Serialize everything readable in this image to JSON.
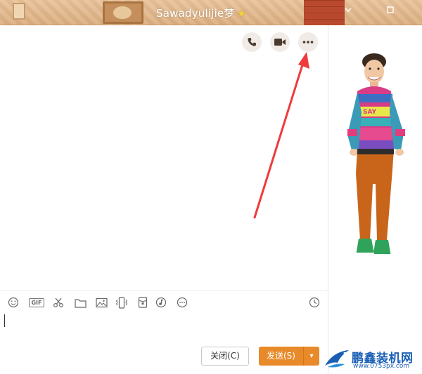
{
  "window": {
    "title": "Sawadyulijie梦",
    "title_badge": "★",
    "minimize_icon": "chevron-down",
    "maximize_icon": "square"
  },
  "chat_actions": [
    {
      "name": "voice-call",
      "icon": "phone-icon"
    },
    {
      "name": "video-call",
      "icon": "video-camera-icon"
    },
    {
      "name": "more",
      "icon": "ellipsis-icon"
    }
  ],
  "toolbar": [
    {
      "name": "emoji",
      "icon": "smiley-icon"
    },
    {
      "name": "gif",
      "icon": "gif-icon",
      "label": "GIF"
    },
    {
      "name": "screenshot",
      "icon": "scissors-icon"
    },
    {
      "name": "file",
      "icon": "folder-icon"
    },
    {
      "name": "image",
      "icon": "image-icon"
    },
    {
      "name": "shake",
      "icon": "vibrate-phone-icon"
    },
    {
      "name": "red-packet",
      "icon": "red-packet-icon"
    },
    {
      "name": "music",
      "icon": "music-icon"
    },
    {
      "name": "more-tools",
      "icon": "circle-ellipsis-icon"
    },
    {
      "name": "history",
      "icon": "clock-icon"
    }
  ],
  "input": {
    "value": ""
  },
  "buttons": {
    "close_label": "关闭(C)",
    "send_label": "发送(S)",
    "send_dropdown": "▾"
  },
  "watermark": {
    "brand": "鹏鑫装机网",
    "url": "www.0753px.com"
  },
  "colors": {
    "accent": "#e88a2a",
    "annotation": "#ef3b3b",
    "title_bar": "#dcae80",
    "watermark": "#1a5fb4"
  }
}
